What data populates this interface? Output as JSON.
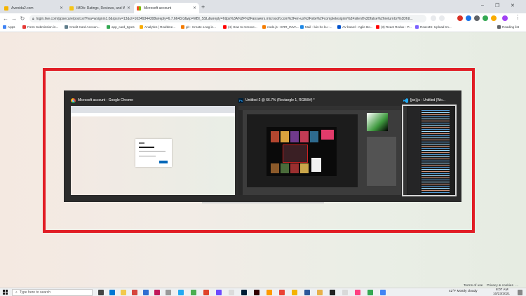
{
  "browser": {
    "tabs": [
      {
        "title": "Avenida2.com",
        "fav_color": "#f4b400",
        "active": false
      },
      {
        "title": "IMDb: Ratings, Reviews, and Wh...",
        "fav_color": "#f5c518",
        "active": false
      },
      {
        "title": "Microsoft account",
        "fav_color": "#f25022",
        "active": true
      }
    ],
    "new_tab": "+",
    "url": "login.live.com/ppsecure/post.srf?wa=wsignin1.0&rpsnv=13&ct=16349344308wreply=6.7.6643.0&wp=MBI_SSL&wreply=https%3A%2F%2Fanswers.microsoft.com%2Fen-us%2Fsite%2Fcompletesignin%3Fsilent%3Dfalse%26returnUrl%3Dhtt...",
    "bookmarks": [
      {
        "label": "Apps",
        "color": "#4285f4"
      },
      {
        "label": "Form Submission in...",
        "color": "#e53935"
      },
      {
        "label": "Credit Card Accoun...",
        "color": "#607d8b"
      },
      {
        "label": "app_card_types",
        "color": "#34a853"
      },
      {
        "label": "Analytics | Realtime...",
        "color": "#f9ab00"
      },
      {
        "label": "git - Create a tag in...",
        "color": "#f57c00"
      },
      {
        "label": "(4) How to remove...",
        "color": "#ff0000"
      },
      {
        "label": "node.js - ERR_INVA...",
        "color": "#f57c00"
      },
      {
        "label": "Mail - luis ho ku -...",
        "color": "#1e88e5"
      },
      {
        "label": "AV board - Agile Bo...",
        "color": "#0052cc"
      },
      {
        "label": "(3) React Redux - P...",
        "color": "#ff0000"
      },
      {
        "label": "ReactJS: Upload Im...",
        "color": "#7b61ff"
      },
      {
        "label": "Reading list",
        "color": "#5f6368"
      }
    ]
  },
  "task_switcher": {
    "windows": [
      {
        "title": "Microsoft account - Google Chrome",
        "app": "chrome-icon"
      },
      {
        "title": "Untitled-2 @ 66.7% (Rectangle 1, RGB/8#) *",
        "app": "photoshop-icon"
      },
      {
        "title": "[jsx].js - Untitled (Wo...",
        "app": "vscode-icon"
      }
    ],
    "ps_label": "Ps"
  },
  "page_footer": {
    "terms": "Terms of use",
    "privacy": "Privacy & cookies",
    "more": "..."
  },
  "taskbar": {
    "search_placeholder": "Type here to search",
    "weather": "42°F  Mostly cloudy",
    "time": "8:07 AM",
    "date": "10/23/2021"
  }
}
